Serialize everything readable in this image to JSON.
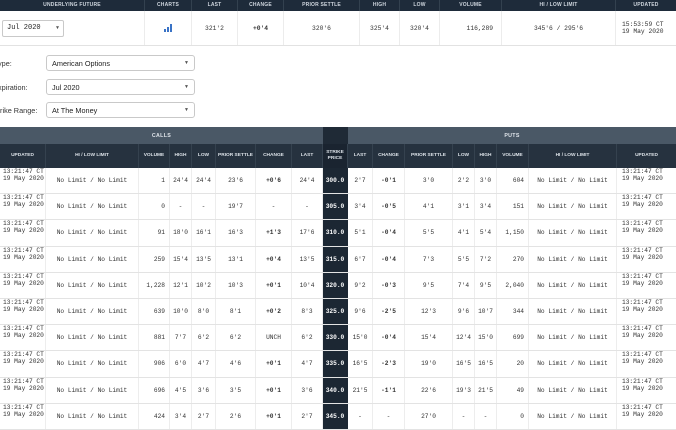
{
  "future": {
    "headers": [
      "UNDERLYING FUTURE",
      "CHARTS",
      "LAST",
      "CHANGE",
      "PRIOR SETTLE",
      "HIGH",
      "LOW",
      "VOLUME",
      "HI / LOW LIMIT",
      "UPDATED"
    ],
    "contract": "Jul 2020",
    "last": "321'2",
    "change": "+0'4",
    "prior_settle": "320'6",
    "high": "325'4",
    "low": "320'4",
    "volume": "116,289",
    "hi_low_limit": "345'6 / 295'6",
    "updated_time": "15:53:59 CT",
    "updated_date": "19 May 2020"
  },
  "filters": {
    "type_label": "ype:",
    "type_value": "American Options",
    "expiration_label": "xpiration:",
    "expiration_value": "Jul 2020",
    "strike_label": "trike Range:",
    "strike_value": "At The Money"
  },
  "table": {
    "calls_label": "CALLS",
    "puts_label": "PUTS",
    "call_headers": [
      "UPDATED",
      "HI / LOW LIMIT",
      "VOLUME",
      "HIGH",
      "LOW",
      "PRIOR SETTLE",
      "CHANGE",
      "LAST"
    ],
    "strike_header": "STRIKE PRICE",
    "put_headers": [
      "LAST",
      "CHANGE",
      "PRIOR SETTLE",
      "LOW",
      "HIGH",
      "VOLUME",
      "HI / LOW LIMIT",
      "UPDATED"
    ],
    "rows": [
      {
        "c_time": "13:21:47 CT",
        "c_date": "19 May 2020",
        "c_limit": "No Limit / No Limit",
        "c_vol": "1",
        "c_high": "24'4",
        "c_low": "24'4",
        "c_prior": "23'6",
        "c_change": "+0'6",
        "c_change_dir": "pos",
        "c_last": "24'4",
        "strike": "300.0",
        "p_last": "2'7",
        "p_change": "-0'1",
        "p_change_dir": "neg",
        "p_prior": "3'0",
        "p_low": "2'2",
        "p_high": "3'0",
        "p_vol": "604",
        "p_limit": "No Limit / No Limit",
        "p_time": "13:21:47 CT",
        "p_date": "19 May 2020"
      },
      {
        "c_time": "13:21:47 CT",
        "c_date": "19 May 2020",
        "c_limit": "No Limit / No Limit",
        "c_vol": "0",
        "c_high": "-",
        "c_low": "-",
        "c_prior": "19'7",
        "c_change": "-",
        "c_change_dir": "none",
        "c_last": "-",
        "strike": "305.0",
        "p_last": "3'4",
        "p_change": "-0'5",
        "p_change_dir": "neg",
        "p_prior": "4'1",
        "p_low": "3'1",
        "p_high": "3'4",
        "p_vol": "151",
        "p_limit": "No Limit / No Limit",
        "p_time": "13:21:47 CT",
        "p_date": "19 May 2020"
      },
      {
        "c_time": "13:21:47 CT",
        "c_date": "19 May 2020",
        "c_limit": "No Limit / No Limit",
        "c_vol": "91",
        "c_high": "18'0",
        "c_low": "16'1",
        "c_prior": "16'3",
        "c_change": "+1'3",
        "c_change_dir": "pos",
        "c_last": "17'6",
        "strike": "310.0",
        "p_last": "5'1",
        "p_change": "-0'4",
        "p_change_dir": "neg",
        "p_prior": "5'5",
        "p_low": "4'1",
        "p_high": "5'4",
        "p_vol": "1,150",
        "p_limit": "No Limit / No Limit",
        "p_time": "13:21:47 CT",
        "p_date": "19 May 2020"
      },
      {
        "c_time": "13:21:47 CT",
        "c_date": "19 May 2020",
        "c_limit": "No Limit / No Limit",
        "c_vol": "259",
        "c_high": "15'4",
        "c_low": "13'5",
        "c_prior": "13'1",
        "c_change": "+0'4",
        "c_change_dir": "pos",
        "c_last": "13'5",
        "strike": "315.0",
        "p_last": "6'7",
        "p_change": "-0'4",
        "p_change_dir": "neg",
        "p_prior": "7'3",
        "p_low": "5'5",
        "p_high": "7'2",
        "p_vol": "270",
        "p_limit": "No Limit / No Limit",
        "p_time": "13:21:47 CT",
        "p_date": "19 May 2020"
      },
      {
        "c_time": "13:21:47 CT",
        "c_date": "19 May 2020",
        "c_limit": "No Limit / No Limit",
        "c_vol": "1,228",
        "c_high": "12'1",
        "c_low": "10'2",
        "c_prior": "10'3",
        "c_change": "+0'1",
        "c_change_dir": "pos",
        "c_last": "10'4",
        "strike": "320.0",
        "p_last": "9'2",
        "p_change": "-0'3",
        "p_change_dir": "neg",
        "p_prior": "9'5",
        "p_low": "7'4",
        "p_high": "9'5",
        "p_vol": "2,040",
        "p_limit": "No Limit / No Limit",
        "p_time": "13:21:47 CT",
        "p_date": "19 May 2020"
      },
      {
        "c_time": "13:21:47 CT",
        "c_date": "19 May 2020",
        "c_limit": "No Limit / No Limit",
        "c_vol": "639",
        "c_high": "10'0",
        "c_low": "8'0",
        "c_prior": "8'1",
        "c_change": "+0'2",
        "c_change_dir": "pos",
        "c_last": "8'3",
        "strike": "325.0",
        "p_last": "9'6",
        "p_change": "-2'5",
        "p_change_dir": "neg",
        "p_prior": "12'3",
        "p_low": "9'6",
        "p_high": "10'7",
        "p_vol": "344",
        "p_limit": "No Limit / No Limit",
        "p_time": "13:21:47 CT",
        "p_date": "19 May 2020"
      },
      {
        "c_time": "13:21:47 CT",
        "c_date": "19 May 2020",
        "c_limit": "No Limit / No Limit",
        "c_vol": "881",
        "c_high": "7'7",
        "c_low": "6'2",
        "c_prior": "6'2",
        "c_change": "UNCH",
        "c_change_dir": "none",
        "c_last": "6'2",
        "strike": "330.0",
        "p_last": "15'0",
        "p_change": "-0'4",
        "p_change_dir": "neg",
        "p_prior": "15'4",
        "p_low": "12'4",
        "p_high": "15'0",
        "p_vol": "699",
        "p_limit": "No Limit / No Limit",
        "p_time": "13:21:47 CT",
        "p_date": "19 May 2020"
      },
      {
        "c_time": "13:21:47 CT",
        "c_date": "19 May 2020",
        "c_limit": "No Limit / No Limit",
        "c_vol": "906",
        "c_high": "6'0",
        "c_low": "4'7",
        "c_prior": "4'6",
        "c_change": "+0'1",
        "c_change_dir": "pos",
        "c_last": "4'7",
        "strike": "335.0",
        "p_last": "16'5",
        "p_change": "-2'3",
        "p_change_dir": "neg",
        "p_prior": "19'0",
        "p_low": "16'5",
        "p_high": "16'5",
        "p_vol": "20",
        "p_limit": "No Limit / No Limit",
        "p_time": "13:21:47 CT",
        "p_date": "19 May 2020"
      },
      {
        "c_time": "13:21:47 CT",
        "c_date": "19 May 2020",
        "c_limit": "No Limit / No Limit",
        "c_vol": "696",
        "c_high": "4'5",
        "c_low": "3'6",
        "c_prior": "3'5",
        "c_change": "+0'1",
        "c_change_dir": "pos",
        "c_last": "3'6",
        "strike": "340.0",
        "p_last": "21'5",
        "p_change": "-1'1",
        "p_change_dir": "neg",
        "p_prior": "22'6",
        "p_low": "19'3",
        "p_high": "21'5",
        "p_vol": "49",
        "p_limit": "No Limit / No Limit",
        "p_time": "13:21:47 CT",
        "p_date": "19 May 2020"
      },
      {
        "c_time": "13:21:47 CT",
        "c_date": "19 May 2020",
        "c_limit": "No Limit / No Limit",
        "c_vol": "424",
        "c_high": "3'4",
        "c_low": "2'7",
        "c_prior": "2'6",
        "c_change": "+0'1",
        "c_change_dir": "pos",
        "c_last": "2'7",
        "strike": "345.0",
        "p_last": "-",
        "p_change": "-",
        "p_change_dir": "none",
        "p_prior": "27'0",
        "p_low": "-",
        "p_high": "-",
        "p_vol": "0",
        "p_limit": "No Limit / No Limit",
        "p_time": "13:21:47 CT",
        "p_date": "19 May 2020"
      }
    ]
  }
}
